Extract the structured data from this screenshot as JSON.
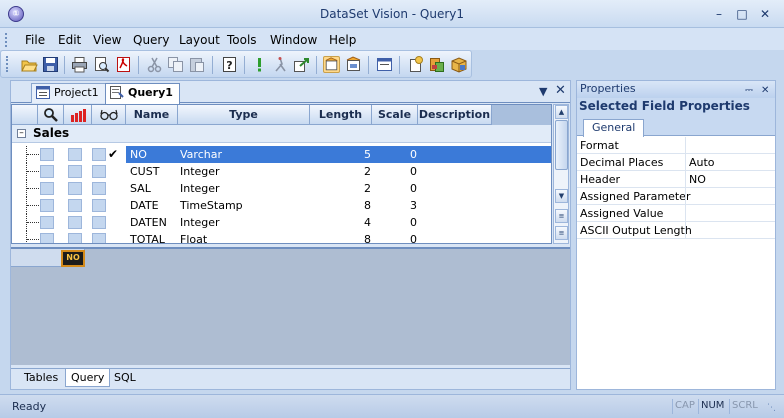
{
  "window": {
    "title": "DataSet Vision - Query1",
    "app_icon_glyph": "①"
  },
  "menu": [
    "File",
    "Edit",
    "View",
    "Query",
    "Layout",
    "Tools",
    "Window",
    "Help"
  ],
  "toolbar": {
    "icons": [
      "open-folder-icon",
      "save-icon",
      "print-icon",
      "print-preview-icon",
      "export-pdf-icon",
      "cut-icon",
      "copy-icon",
      "paste-icon",
      "help-icon",
      "run-query-icon",
      "stop-icon",
      "export-icon",
      "layout-icon",
      "properties-icon",
      "window-icon",
      "new-icon",
      "database-icon",
      "package-icon"
    ]
  },
  "document_tabs": [
    {
      "label": "Project1",
      "active": false
    },
    {
      "label": "Query1",
      "active": true
    }
  ],
  "grid": {
    "columns": [
      "",
      "",
      "",
      "Name",
      "Type",
      "Length",
      "Scale",
      "Description"
    ],
    "group": "Sales",
    "rows": [
      {
        "name": "NO",
        "type": "Varchar",
        "length": "5",
        "scale": "0",
        "description": "",
        "checked": true,
        "selected": true
      },
      {
        "name": "CUST",
        "type": "Integer",
        "length": "2",
        "scale": "0",
        "description": "",
        "checked": false,
        "selected": false
      },
      {
        "name": "SAL",
        "type": "Integer",
        "length": "2",
        "scale": "0",
        "description": "",
        "checked": false,
        "selected": false
      },
      {
        "name": "DATE",
        "type": "TimeStamp",
        "length": "8",
        "scale": "3",
        "description": "",
        "checked": false,
        "selected": false
      },
      {
        "name": "DATEN",
        "type": "Integer",
        "length": "4",
        "scale": "0",
        "description": "",
        "checked": false,
        "selected": false
      },
      {
        "name": "TOTAL",
        "type": "Float",
        "length": "8",
        "scale": "0",
        "description": "",
        "checked": false,
        "selected": false
      }
    ],
    "check_glyph": "✔"
  },
  "preview": {
    "cell_label": "NO"
  },
  "bottom_tabs": [
    {
      "label": "Tables",
      "active": false
    },
    {
      "label": "Query",
      "active": true
    },
    {
      "label": "SQL",
      "active": false
    }
  ],
  "properties": {
    "title": "Properties",
    "subtitle": "Selected Field Properties",
    "tab": "General",
    "rows": [
      {
        "name": "Format",
        "value": ""
      },
      {
        "name": "Decimal Places",
        "value": "Auto"
      },
      {
        "name": "Header",
        "value": "NO"
      },
      {
        "name": "Assigned Parameter",
        "value": ""
      },
      {
        "name": "Assigned Value",
        "value": ""
      },
      {
        "name": "ASCII Output Length",
        "value": ""
      }
    ]
  },
  "status": {
    "text": "Ready",
    "indicators": [
      {
        "label": "CAP",
        "on": false
      },
      {
        "label": "NUM",
        "on": true
      },
      {
        "label": "SCRL",
        "on": false
      }
    ]
  },
  "colors": {
    "selection": "#3b7ad8",
    "accent": "#1e3a6e"
  }
}
